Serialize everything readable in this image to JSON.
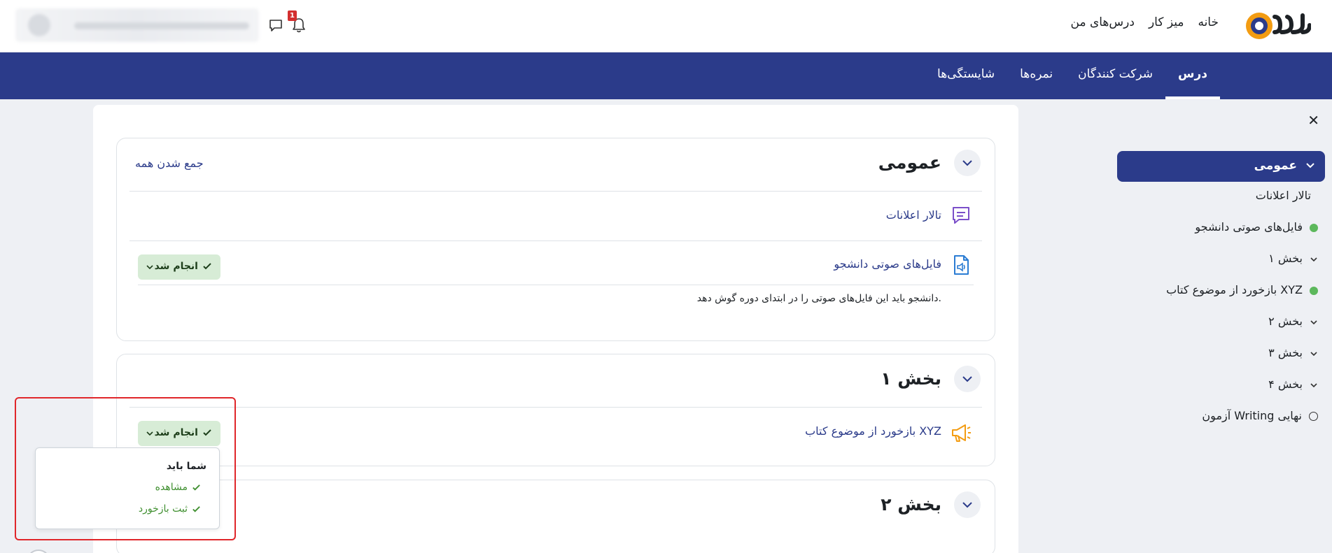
{
  "header": {
    "nav": [
      "خانه",
      "میز کار",
      "درس‌های من"
    ],
    "notification_count": "1"
  },
  "course_nav": {
    "tabs": [
      "درس",
      "شرکت کنندگان",
      "نمره‌ها",
      "شایستگی‌ها"
    ],
    "active_tab": "درس"
  },
  "drawer": {
    "close_symbol": "✕",
    "active_section": "عمومی",
    "items": [
      {
        "label": "تالار اعلانات",
        "marker": "none"
      },
      {
        "label": "فایل‌های صوتی دانشجو",
        "marker": "done"
      },
      {
        "label": "بخش ۱",
        "marker": "chevron"
      },
      {
        "label": "بازخورد از موضوع کتاب XYZ",
        "marker": "done"
      },
      {
        "label": "بخش ۲",
        "marker": "chevron"
      },
      {
        "label": "بخش ۳",
        "marker": "chevron"
      },
      {
        "label": "بخش ۴",
        "marker": "chevron"
      },
      {
        "label": "آزمون Writing نهایی",
        "marker": "empty"
      }
    ]
  },
  "main": {
    "collapse_all": "جمع شدن همه",
    "general": {
      "title": "عمومی",
      "forum": "تالار اعلانات",
      "audio_files": "فایل‌های صوتی دانشجو",
      "audio_desc": "دانشجو باید این فایل‌های صوتی را در ابتدای دوره گوش دهد.",
      "done_label": "انجام شد"
    },
    "section1": {
      "title": "بخش ۱",
      "feedback": "بازخورد از موضوع کتاب XYZ",
      "done_label": "انجام شد"
    },
    "section2": {
      "title": "بخش ۲"
    }
  },
  "popover": {
    "title": "شما باید",
    "items": [
      "مشاهده",
      "ثبت بازخورد"
    ]
  },
  "colors": {
    "brand": "#2b3b8a",
    "done_bg": "#d7ecd6",
    "done_text": "#3f8f2f",
    "highlight": "#e0262a"
  }
}
